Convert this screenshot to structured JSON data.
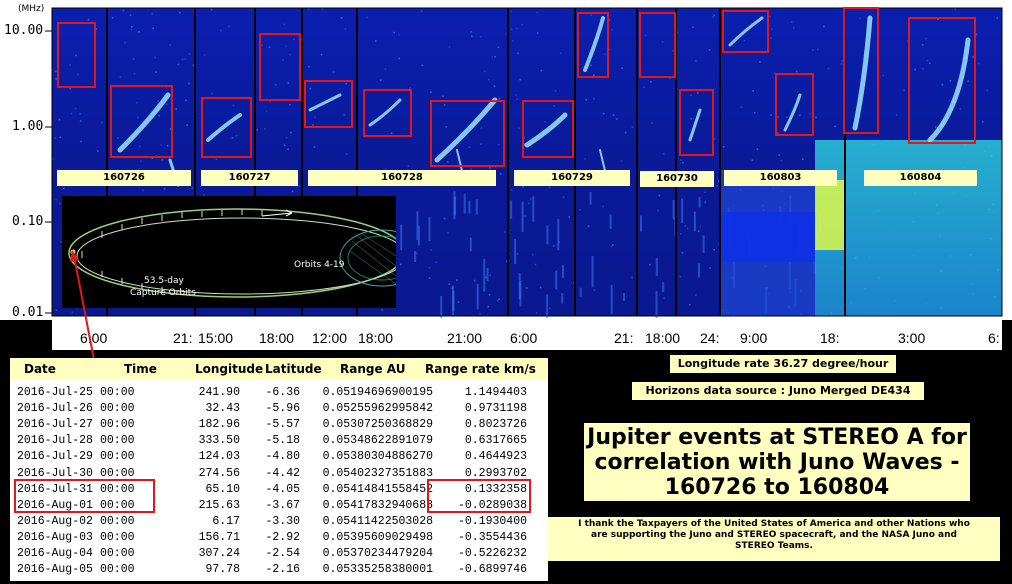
{
  "chart_data": {
    "type": "heatmap",
    "title": "",
    "y_axis": {
      "unit": "(MHz)",
      "scale": "log",
      "ticks": [
        "10.00",
        "1.00",
        "0.10",
        "0.01"
      ]
    },
    "x_axis": {
      "ticks": [
        "6:00",
        "21:",
        "15:00",
        "18:00",
        "12:00",
        "18:00",
        "21:00",
        "6:00",
        "21:",
        "18:00",
        "24:",
        "9:00",
        "18:",
        "3:00",
        "6:"
      ]
    },
    "panels": [
      {
        "label": "160726"
      },
      {
        "label": "160727"
      },
      {
        "label": "160728"
      },
      {
        "label": "160729"
      },
      {
        "label": "160730"
      },
      {
        "label": "160803"
      },
      {
        "label": "160804"
      }
    ],
    "colors": {
      "background": "#0a1a9a",
      "emission": "#7fd8ff",
      "highlight_box": "#e01818",
      "label_bg": "#ffffc0"
    }
  },
  "inset": {
    "label_orbits": "Orbits 4-19",
    "label_capture_1": "53.5-day",
    "label_capture_2": "Capture Orbits"
  },
  "table": {
    "headers": [
      "Date",
      "Time",
      "Longitude",
      "Latitude",
      "Range AU",
      "Range rate km/s"
    ],
    "rows": [
      {
        "date": "2016-Jul-25",
        "time": "00:00",
        "lon": "241.90",
        "lat": "-6.36",
        "range": "0.05194696900195",
        "rate": "1.1494403"
      },
      {
        "date": "2016-Jul-26",
        "time": "00:00",
        "lon": "32.43",
        "lat": "-5.96",
        "range": "0.05255962995842",
        "rate": "0.9731198"
      },
      {
        "date": "2016-Jul-27",
        "time": "00:00",
        "lon": "182.96",
        "lat": "-5.57",
        "range": "0.05307250368829",
        "rate": "0.8023726"
      },
      {
        "date": "2016-Jul-28",
        "time": "00:00",
        "lon": "333.50",
        "lat": "-5.18",
        "range": "0.05348622891079",
        "rate": "0.6317665"
      },
      {
        "date": "2016-Jul-29",
        "time": "00:00",
        "lon": "124.03",
        "lat": "-4.80",
        "range": "0.05380304886270",
        "rate": "0.4644923"
      },
      {
        "date": "2016-Jul-30",
        "time": "00:00",
        "lon": "274.56",
        "lat": "-4.42",
        "range": "0.05402327351883",
        "rate": "0.2993702"
      },
      {
        "date": "2016-Jul-31",
        "time": "00:00",
        "lon": "65.10",
        "lat": "-4.05",
        "range": "0.05414841558452",
        "rate": "0.1332358"
      },
      {
        "date": "2016-Aug-01",
        "time": "00:00",
        "lon": "215.63",
        "lat": "-3.67",
        "range": "0.05417832940688",
        "rate": "-0.0289038"
      },
      {
        "date": "2016-Aug-02",
        "time": "00:00",
        "lon": "6.17",
        "lat": "-3.30",
        "range": "0.05411422503028",
        "rate": "-0.1930400"
      },
      {
        "date": "2016-Aug-03",
        "time": "00:00",
        "lon": "156.71",
        "lat": "-2.92",
        "range": "0.05395609029498",
        "rate": "-0.3554436"
      },
      {
        "date": "2016-Aug-04",
        "time": "00:00",
        "lon": "307.24",
        "lat": "-2.54",
        "range": "0.05370234479204",
        "rate": "-0.5226232"
      },
      {
        "date": "2016-Aug-05",
        "time": "00:00",
        "lon": "97.78",
        "lat": "-2.16",
        "range": "0.05335258380001",
        "rate": "-0.6899746"
      }
    ]
  },
  "notes": {
    "longitude_rate": "Longitude rate 36.27 degree/hour",
    "horizons": "Horizons data source : Juno Merged DE434",
    "title_line1": "Jupiter events at STEREO A for",
    "title_line2": "correlation with Juno Waves -",
    "title_line3": "160726 to 160804",
    "thanks_line1": "I thank the Taxpayers of the United States of America and other Nations who",
    "thanks_line2": "are supporting the Juno and STEREO  spacecraft, and the NASA Juno and",
    "thanks_line3": "STEREO Teams."
  }
}
